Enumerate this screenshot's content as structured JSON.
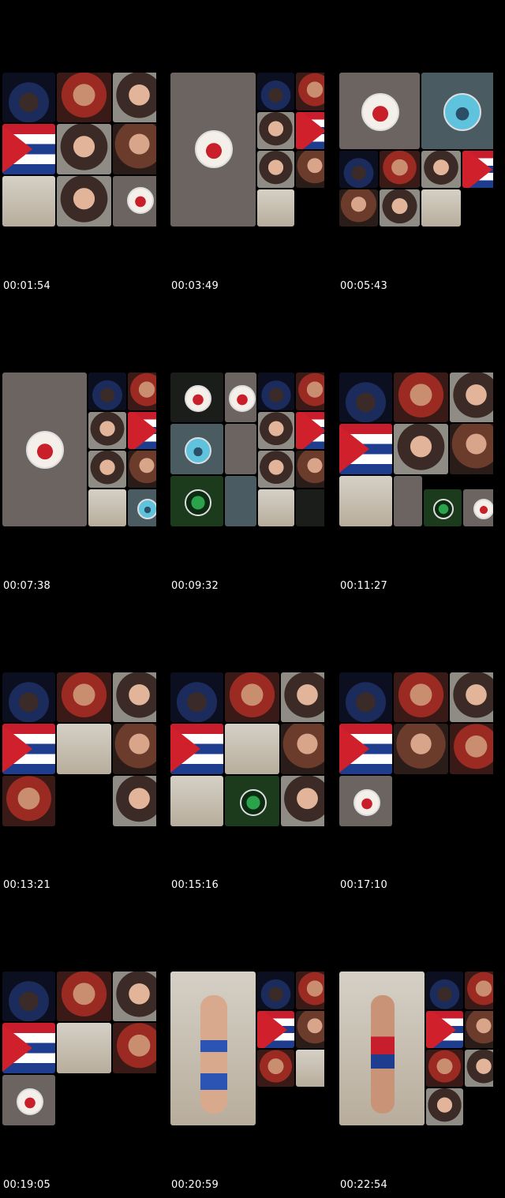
{
  "timestamps": [
    "00:01:54",
    "00:03:49",
    "00:05:43",
    "00:07:38",
    "00:09:32",
    "00:11:27",
    "00:13:21",
    "00:15:16",
    "00:17:10",
    "00:19:05",
    "00:20:59",
    "00:22:54"
  ]
}
